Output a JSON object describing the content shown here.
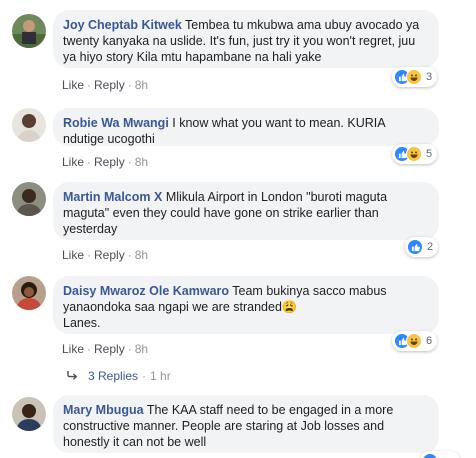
{
  "comments": [
    {
      "author": "Joy Cheptab Kitwek",
      "text": "Tembea tu mkubwa ama ubuy avocado ya twenty kanyaka na uslide. It's fun, just try it you won't regret, juu ya hiyo story Kila mtu hapambane na hali yake",
      "like": "Like",
      "reply": "Reply",
      "time": "8h",
      "reactions": "3"
    },
    {
      "author": "Robie Wa Mwangi",
      "text": "I know what you want to mean. KURIA ndutige ucogothi",
      "like": "Like",
      "reply": "Reply",
      "time": "8h",
      "reactions": "5"
    },
    {
      "author": "Martin Malcom X",
      "text": "Mlikula Airport in London \"buroti maguta maguta\" even they could have gone on strike earlier than yesterday",
      "like": "Like",
      "reply": "Reply",
      "time": "8h",
      "reactions": "2"
    },
    {
      "author": "Daisy Mwaroz Ole Kamwaro",
      "text": "Team bukinya sacco mabus yanaondoka saa ngapi we are stranded😩",
      "text2": "Lanes.",
      "like": "Like",
      "reply": "Reply",
      "time": "8h",
      "reactions": "6"
    },
    {
      "author": "Mary Mbugua",
      "text": "The KAA staff need to be engaged in a more constructive manner. People are staring at Job losses and honestly it can not be well"
    }
  ],
  "replies": {
    "label": "3 Replies",
    "time": "1 hr"
  },
  "icons": {
    "like": "like-reaction-icon",
    "haha": "haha-reaction-icon",
    "reply_arrow": "reply-arrow-icon"
  },
  "colors": {
    "author": "#385898",
    "bubble": "#f2f3f5",
    "like": "#2d88ff",
    "haha": "#f7c443"
  }
}
